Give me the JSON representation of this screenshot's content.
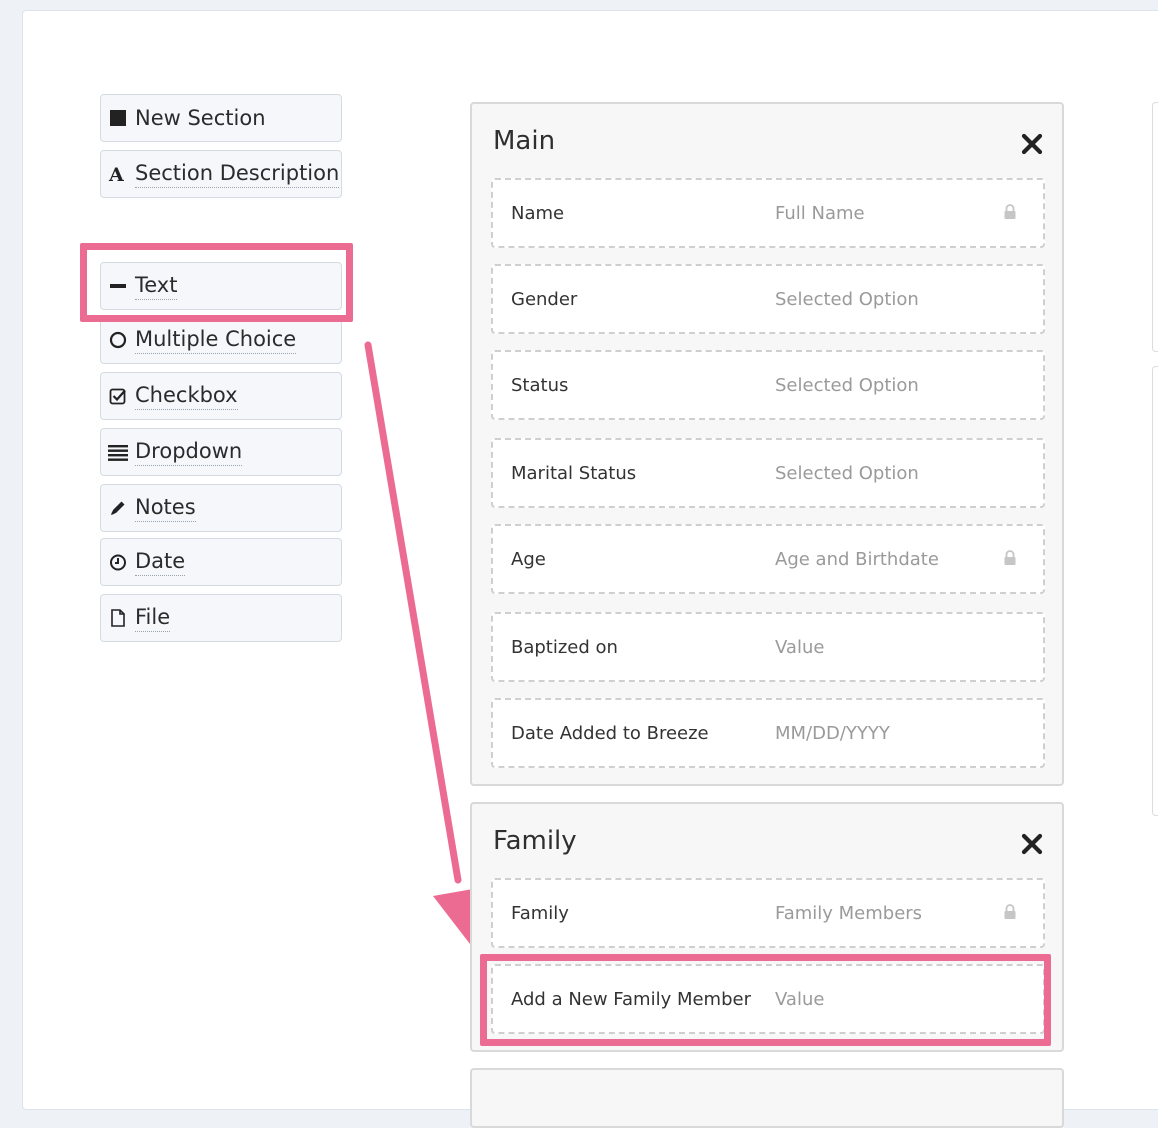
{
  "palette": {
    "new_section": "New Section",
    "section_description": "Section Description",
    "text": "Text",
    "multiple_choice": "Multiple Choice",
    "checkbox": "Checkbox",
    "dropdown": "Dropdown",
    "notes": "Notes",
    "date": "Date",
    "file": "File"
  },
  "sections": {
    "main": {
      "title": "Main",
      "fields": [
        {
          "name": "Name",
          "value": "Full Name",
          "locked": true
        },
        {
          "name": "Gender",
          "value": "Selected Option",
          "locked": false
        },
        {
          "name": "Status",
          "value": "Selected Option",
          "locked": false
        },
        {
          "name": "Marital Status",
          "value": "Selected Option",
          "locked": false
        },
        {
          "name": "Age",
          "value": "Age and Birthdate",
          "locked": true
        },
        {
          "name": "Baptized on",
          "value": "Value",
          "locked": false
        },
        {
          "name": "Date Added to Breeze",
          "value": "MM/DD/YYYY",
          "locked": false
        }
      ]
    },
    "family": {
      "title": "Family",
      "fields": [
        {
          "name": "Family",
          "value": "Family Members",
          "locked": true
        },
        {
          "name": "Add a New Family Member",
          "value": "Value",
          "locked": false
        }
      ]
    }
  },
  "annotation_color": "#ec6b92"
}
